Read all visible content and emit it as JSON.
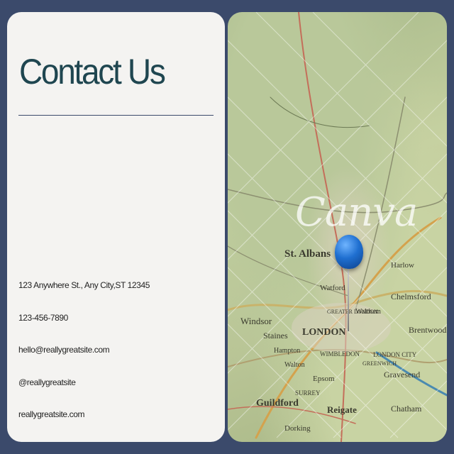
{
  "contact": {
    "title": "Contact Us",
    "address": "123 Anywhere St., Any City,ST 12345",
    "phone": "123-456-7890",
    "email": "hello@reallygreatsite.com",
    "social": "@reallygreatsite",
    "website": "reallygreatsite.com"
  },
  "map": {
    "watermark": "Canva",
    "labels": [
      "St. Albans",
      "Watford",
      "LONDON",
      "GREATER LONDON",
      "Windsor",
      "Staines",
      "Hampton",
      "WIMBLEDON",
      "Epsom",
      "Reigate",
      "Guildford",
      "Gravesend",
      "Chatham",
      "Brentwood",
      "Chelmsford",
      "Waltham",
      "GREENWICH",
      "LONDON CITY",
      "SURREY",
      "Walton",
      "Harlow",
      "Dorking"
    ],
    "pin_color": "#1f6fd0"
  },
  "colors": {
    "background": "#3b4a6b",
    "card": "#f4f3f1",
    "title": "#1f4650"
  }
}
